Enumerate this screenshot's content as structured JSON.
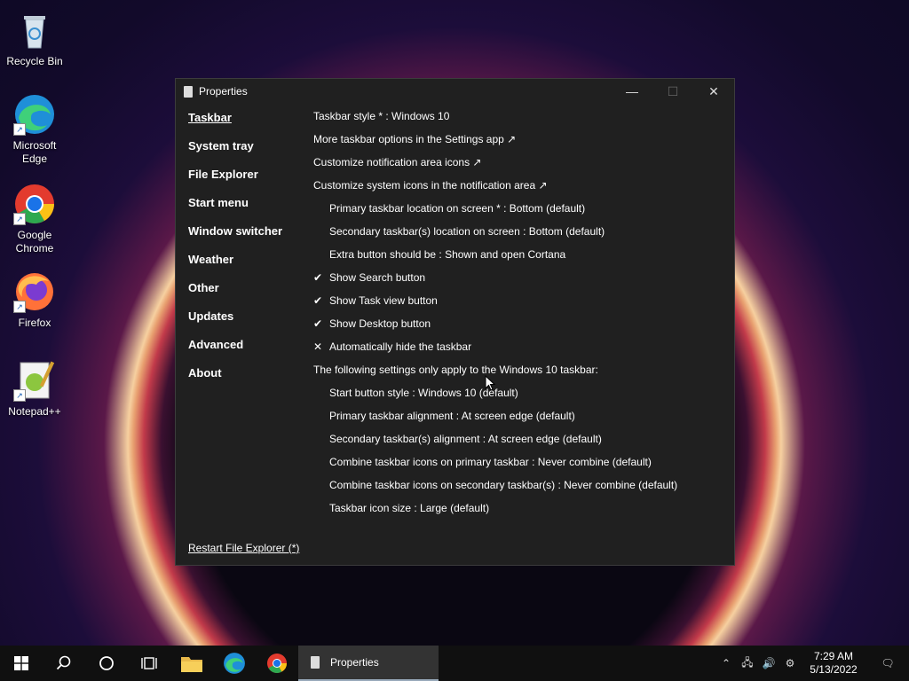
{
  "desktop": {
    "icons": [
      {
        "label": "Recycle Bin"
      },
      {
        "label": "Microsoft Edge"
      },
      {
        "label": "Google Chrome"
      },
      {
        "label": "Firefox"
      },
      {
        "label": "Notepad++"
      }
    ]
  },
  "window": {
    "title": "Properties",
    "nav": [
      "Taskbar",
      "System tray",
      "File Explorer",
      "Start menu",
      "Window switcher",
      "Weather",
      "Other",
      "Updates",
      "Advanced",
      "About"
    ],
    "rows": [
      {
        "text": "Taskbar style * : Windows 10"
      },
      {
        "text": "More taskbar options in the Settings app ↗"
      },
      {
        "text": "Customize notification area icons ↗"
      },
      {
        "text": "Customize system icons in the notification area ↗"
      },
      {
        "text": "Primary taskbar location on screen * : Bottom (default)"
      },
      {
        "text": "Secondary taskbar(s) location on screen : Bottom (default)"
      },
      {
        "text": "Extra button should be : Shown and open Cortana"
      },
      {
        "text": "Show Search button",
        "mark": "✔"
      },
      {
        "text": "Show Task view button",
        "mark": "✔"
      },
      {
        "text": "Show Desktop button",
        "mark": "✔"
      },
      {
        "text": "Automatically hide the taskbar",
        "mark": "✕"
      },
      {
        "text": "The following settings only apply to the Windows 10 taskbar:"
      },
      {
        "text": "Start button style : Windows 10 (default)"
      },
      {
        "text": "Primary taskbar alignment : At screen edge (default)"
      },
      {
        "text": "Secondary taskbar(s) alignment : At screen edge (default)"
      },
      {
        "text": "Combine taskbar icons on primary taskbar : Never combine (default)"
      },
      {
        "text": "Combine taskbar icons on secondary taskbar(s) : Never combine (default)"
      },
      {
        "text": "Taskbar icon size : Large (default)"
      }
    ],
    "restart_label": "Restart File Explorer (*)"
  },
  "taskbar": {
    "active_task": "Properties",
    "time": "7:29 AM",
    "date": "5/13/2022"
  },
  "colors": {
    "window_bg": "#202020",
    "taskbar_bg": "#101010"
  }
}
